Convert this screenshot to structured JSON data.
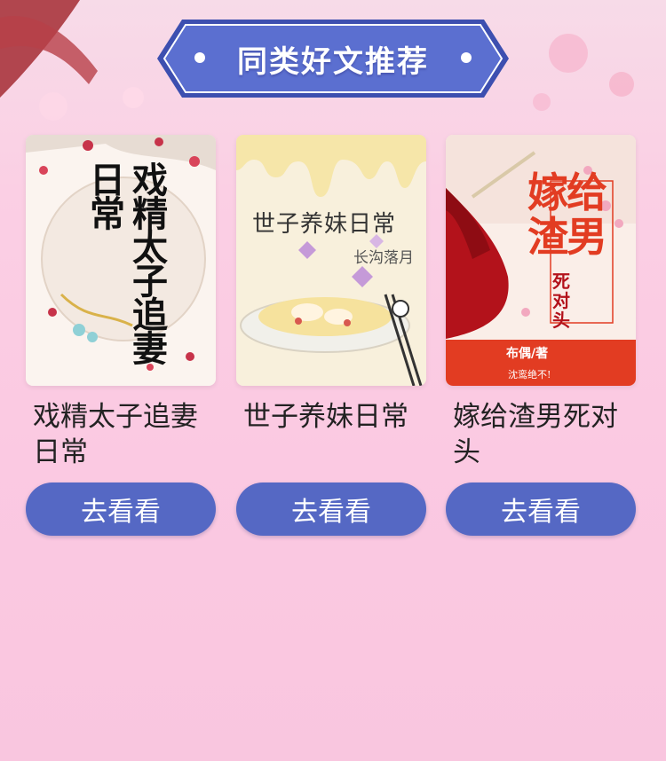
{
  "header": {
    "title": "同类好文推荐"
  },
  "books": [
    {
      "title": "戏精太子追妻日常",
      "button_label": "去看看",
      "cover": {
        "title_text": "戏精太子追妻日常"
      }
    },
    {
      "title": "世子养妹日常",
      "button_label": "去看看",
      "cover": {
        "title_text": "世子养妹日常",
        "author_text": "长沟落月"
      }
    },
    {
      "title": "嫁给渣男死对头",
      "button_label": "去看看",
      "cover": {
        "title_text": "嫁给渣男",
        "subtitle_text": "死对头",
        "author_text": "布偶/著",
        "tagline_text": "沈鸾绝不!"
      }
    }
  ],
  "colors": {
    "accent": "#5568c4",
    "banner_border": "#3d4fb0",
    "background": "#fbc9e2"
  }
}
